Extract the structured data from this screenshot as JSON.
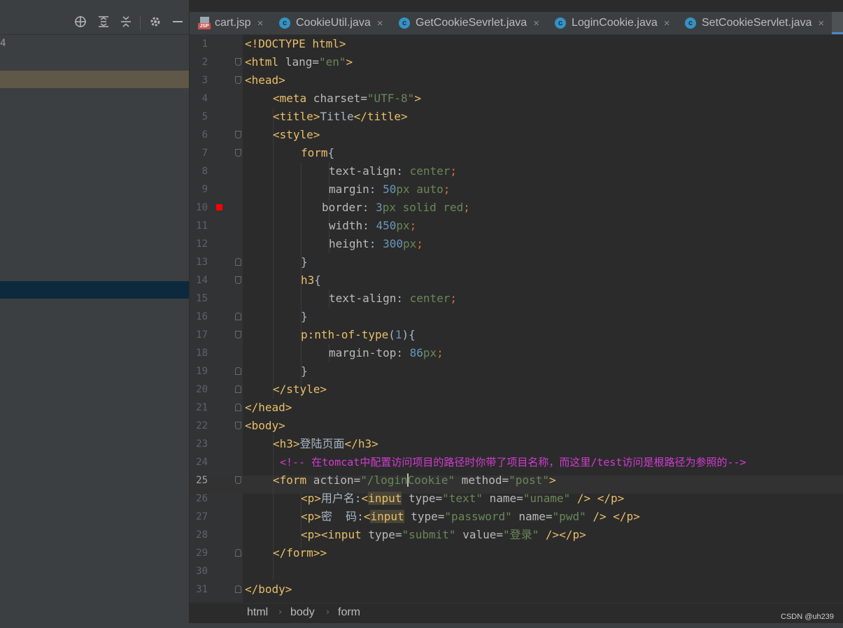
{
  "left_panel": {
    "visible_number": "4"
  },
  "toolbar": {
    "locate_icon": "crosshair-icon",
    "expand_icon": "expand-all-icon",
    "collapse_icon": "collapse-all-icon",
    "settings_icon": "gear-icon",
    "hide_icon": "minimize-icon"
  },
  "tabs": [
    {
      "label": "cart.jsp",
      "icon": "jsp-file-icon",
      "icon_text": "JSP"
    },
    {
      "label": "CookieUtil.java",
      "icon": "java-class-icon",
      "icon_text": "c"
    },
    {
      "label": "GetCookieSevrlet.java",
      "icon": "java-class-icon",
      "icon_text": "c"
    },
    {
      "label": "LoginCookie.java",
      "icon": "java-class-icon",
      "icon_text": "c"
    },
    {
      "label": "SetCookieServlet.java",
      "icon": "java-class-icon",
      "icon_text": "c"
    }
  ],
  "close_glyph": "×",
  "editor": {
    "current_line": 25,
    "breakpoint_line": 10,
    "line_numbers": [
      "1",
      "2",
      "3",
      "4",
      "5",
      "6",
      "7",
      "8",
      "9",
      "10",
      "11",
      "12",
      "13",
      "14",
      "15",
      "16",
      "17",
      "18",
      "19",
      "20",
      "21",
      "22",
      "23",
      "24",
      "25",
      "26",
      "27",
      "28",
      "29",
      "30",
      "31"
    ]
  },
  "code": {
    "l1": [
      "<!DOCTYPE html>"
    ],
    "l2": [
      "<html",
      " lang=",
      "\"en\"",
      ">"
    ],
    "l3": [
      "<head>"
    ],
    "l4": [
      "<meta",
      " charset=",
      "\"UTF-8\"",
      ">"
    ],
    "l5": [
      "<title>",
      "Title",
      "</title>"
    ],
    "l6": [
      "<style>"
    ],
    "l7": [
      "form",
      "{"
    ],
    "l8": [
      "text-align",
      ": ",
      "center",
      ";"
    ],
    "l9": [
      "margin",
      ": ",
      "50",
      "px",
      " auto",
      ";"
    ],
    "l10": [
      "border",
      ": ",
      "3",
      "px",
      " solid red",
      ";"
    ],
    "l11": [
      "width",
      ": ",
      "450",
      "px",
      ";"
    ],
    "l12": [
      "height",
      ": ",
      "300",
      "px",
      ";"
    ],
    "l13": [
      "}"
    ],
    "l14": [
      "h3",
      "{"
    ],
    "l15": [
      "text-align",
      ": ",
      "center",
      ";"
    ],
    "l16": [
      "}"
    ],
    "l17": [
      "p",
      ":nth-of-type",
      "(",
      "1",
      ")",
      "{"
    ],
    "l18": [
      "margin-top",
      ": ",
      "86",
      "px",
      ";"
    ],
    "l19": [
      "}"
    ],
    "l20": [
      "</style>"
    ],
    "l21": [
      "</head>"
    ],
    "l22": [
      "<body>"
    ],
    "l23": [
      "<h3>",
      "登陆页面",
      "</h3>"
    ],
    "l24": [
      "<!-- 在tomcat中配置访问项目的路径时你带了项目名称，而这里/test访问是根路径为参照的-->"
    ],
    "l25": [
      "<form",
      " action=",
      "\"/login",
      "Cookie\"",
      " method=",
      "\"post\"",
      ">"
    ],
    "l26": [
      "<p>",
      "用户名:",
      "<",
      "input",
      " type=",
      "\"text\"",
      " name=",
      "\"uname\"",
      " />",
      " ",
      "</p>"
    ],
    "l27": [
      "<p>",
      "密  码:",
      "<",
      "input",
      " type=",
      "\"password\"",
      " name=",
      "\"pwd\"",
      " />",
      " ",
      "</p>"
    ],
    "l28": [
      "<p>",
      "<input",
      " type=",
      "\"submit\"",
      " value=",
      "\"登录\"",
      " />",
      "</p>"
    ],
    "l29": [
      "</form>",
      ">"
    ],
    "l30": [],
    "l31": [
      "</body>"
    ]
  },
  "breadcrumb": [
    "html",
    "body",
    "form"
  ],
  "breadcrumb_sep": "›",
  "watermark": "CSDN @uh239"
}
